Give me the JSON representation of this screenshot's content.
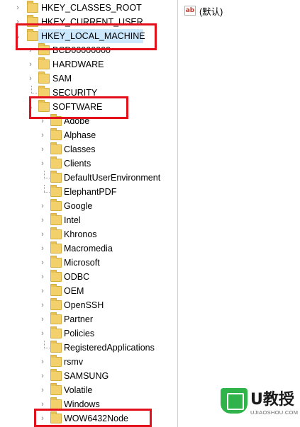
{
  "tree": {
    "top_level": [
      {
        "label": "HKEY_CLASSES_ROOT"
      },
      {
        "label": "HKEY_CURRENT_USER"
      },
      {
        "label": "HKEY_LOCAL_MACHINE"
      }
    ],
    "hklm_children": [
      {
        "label": "BCD00000000"
      },
      {
        "label": "HARDWARE"
      },
      {
        "label": "SAM"
      },
      {
        "label": "SECURITY"
      },
      {
        "label": "SOFTWARE"
      }
    ],
    "software_children": [
      {
        "label": "Adobe"
      },
      {
        "label": "Alphase"
      },
      {
        "label": "Classes"
      },
      {
        "label": "Clients"
      },
      {
        "label": "DefaultUserEnvironment"
      },
      {
        "label": "ElephantPDF"
      },
      {
        "label": "Google"
      },
      {
        "label": "Intel"
      },
      {
        "label": "Khronos"
      },
      {
        "label": "Macromedia"
      },
      {
        "label": "Microsoft"
      },
      {
        "label": "ODBC"
      },
      {
        "label": "OEM"
      },
      {
        "label": "OpenSSH"
      },
      {
        "label": "Partner"
      },
      {
        "label": "Policies"
      },
      {
        "label": "RegisteredApplications"
      },
      {
        "label": "rsmv"
      },
      {
        "label": "SAMSUNG"
      },
      {
        "label": "Volatile"
      },
      {
        "label": "Windows"
      },
      {
        "label": "WOW6432Node"
      }
    ]
  },
  "values_pane": {
    "items": [
      {
        "type_icon": "ab",
        "name": "(默认)"
      }
    ]
  },
  "watermark": {
    "brand": "U教授",
    "url": "UJIAOSHOU.COM"
  },
  "colors": {
    "highlight": "#e3101b",
    "selection": "#cce8ff",
    "folder": "#f2d06b",
    "logo_green": "#2fb34a"
  }
}
